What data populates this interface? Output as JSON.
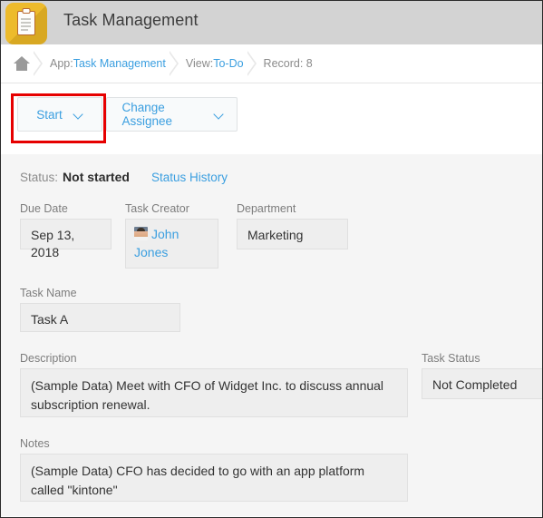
{
  "app": {
    "title": "Task Management",
    "icon": "clipboard-icon"
  },
  "breadcrumb": {
    "home_icon": "home-icon",
    "items": [
      {
        "label": "App: ",
        "link": "Task Management"
      },
      {
        "label": "View: ",
        "link": "To-Do"
      },
      {
        "label": "Record: 8",
        "link": ""
      }
    ],
    "app_prefix": "App: ",
    "app_name": "Task Management",
    "view_prefix": "View: ",
    "view_name": "To-Do",
    "record_text": "Record: 8"
  },
  "actions": {
    "start_label": "Start",
    "change_assignee_label": "Change Assignee",
    "dropdown_icon": "chevron-down-icon",
    "highlighted": "Start"
  },
  "status": {
    "label": "Status:",
    "value": "Not started",
    "history_link": "Status History"
  },
  "fields": {
    "due_date": {
      "label": "Due Date",
      "value": "Sep 13, 2018"
    },
    "task_creator": {
      "label": "Task Creator",
      "value": "John Jones",
      "avatar": "user-avatar"
    },
    "department": {
      "label": "Department",
      "value": "Marketing"
    },
    "task_name": {
      "label": "Task Name",
      "value": "Task A"
    },
    "description": {
      "label": "Description",
      "value": "(Sample Data) Meet with CFO of Widget Inc. to discuss annual subscription renewal."
    },
    "task_status": {
      "label": "Task Status",
      "value": "Not Completed"
    },
    "notes": {
      "label": "Notes",
      "value": "(Sample Data) CFO has decided to go with an app platform called \"kintone\""
    }
  },
  "colors": {
    "link": "#3b9fe0",
    "app_icon": "#edbb2c",
    "header_bar": "#d3d3d3",
    "annotation": "#e60000",
    "body_bg": "#f5f5f5",
    "field_bg": "#eeeeee"
  }
}
